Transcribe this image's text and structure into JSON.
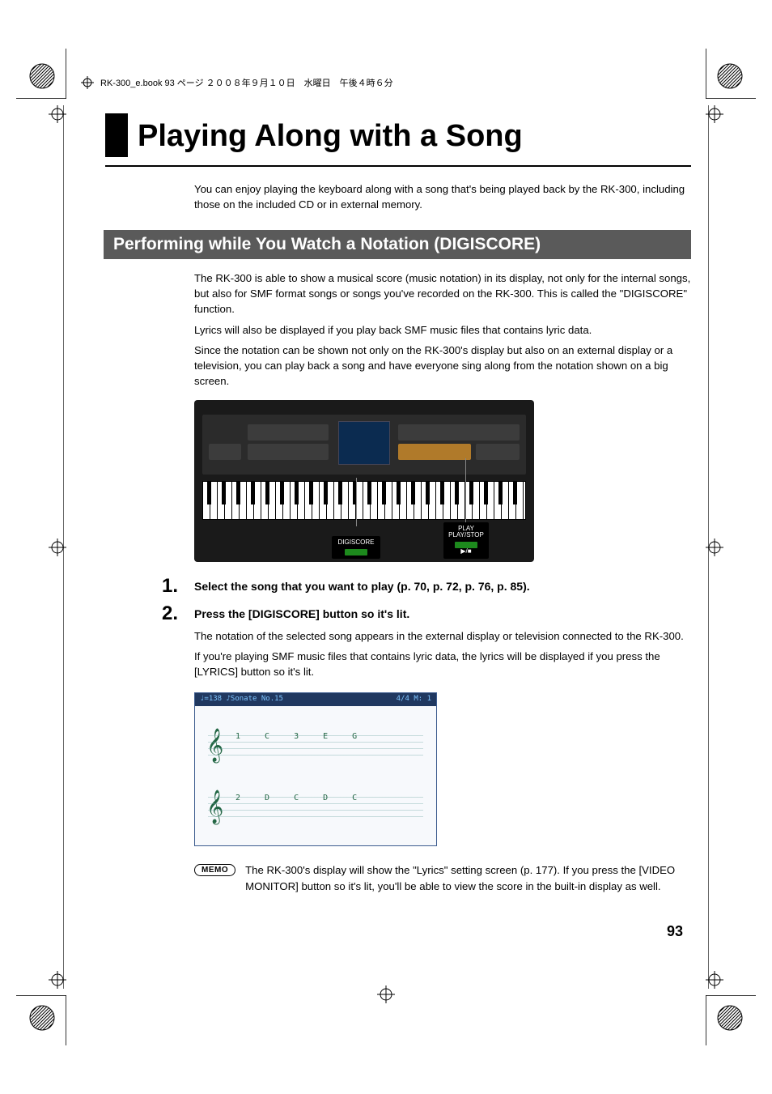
{
  "running_head": "RK-300_e.book 93 ページ ２００８年９月１０日　水曜日　午後４時６分",
  "chapter_title": "Playing Along with a Song",
  "intro_para": "You can enjoy playing the keyboard along with a song that's being played back by the RK-300, including those on the included CD or in external memory.",
  "section_title": "Performing while You Watch a Notation (DIGISCORE)",
  "section_p1": "The RK-300 is able to show a musical score (music notation) in its display, not only for the internal songs, but also for SMF format songs or songs you've recorded on the RK-300. This is called the \"DIGISCORE\" function.",
  "section_p2": "Lyrics will also be displayed if you play back SMF music files that contains lyric data.",
  "section_p3": "Since the notation can be shown not only on the RK-300's display but also on an external display or a television, you can play back a song and have everyone sing along from the notation shown on a big screen.",
  "keyboard": {
    "callout_a_line1": "DIGISCORE",
    "callout_b_line1": "PLAY",
    "callout_b_line2": "PLAY/STOP",
    "callout_b_glyph": "▶/■"
  },
  "steps": [
    {
      "num": "1.",
      "title": "Select the song that you want to play (p. 70, p. 72, p. 76, p. 85)."
    },
    {
      "num": "2.",
      "title": "Press the [DIGISCORE] button so it's lit."
    }
  ],
  "step2_p1": "The notation of the selected song appears in the external display or television connected to the RK-300.",
  "step2_p2": "If you're playing SMF music files that contains lyric data, the lyrics will be displayed if you press the [LYRICS] button so it's lit.",
  "score": {
    "top_left": "♩=138  ♪Sonate No.15",
    "top_right": "4/4  M:  1",
    "row1_notes": "1 C   3 E   G",
    "row2_notes": "2 D   C D C"
  },
  "memo_label": "MEMO",
  "memo_text": "The RK-300's display will show the \"Lyrics\" setting screen (p. 177). If you press the [VIDEO MONITOR] button so it's lit, you'll be able to view the score in the built-in display as well.",
  "page_number": "93"
}
